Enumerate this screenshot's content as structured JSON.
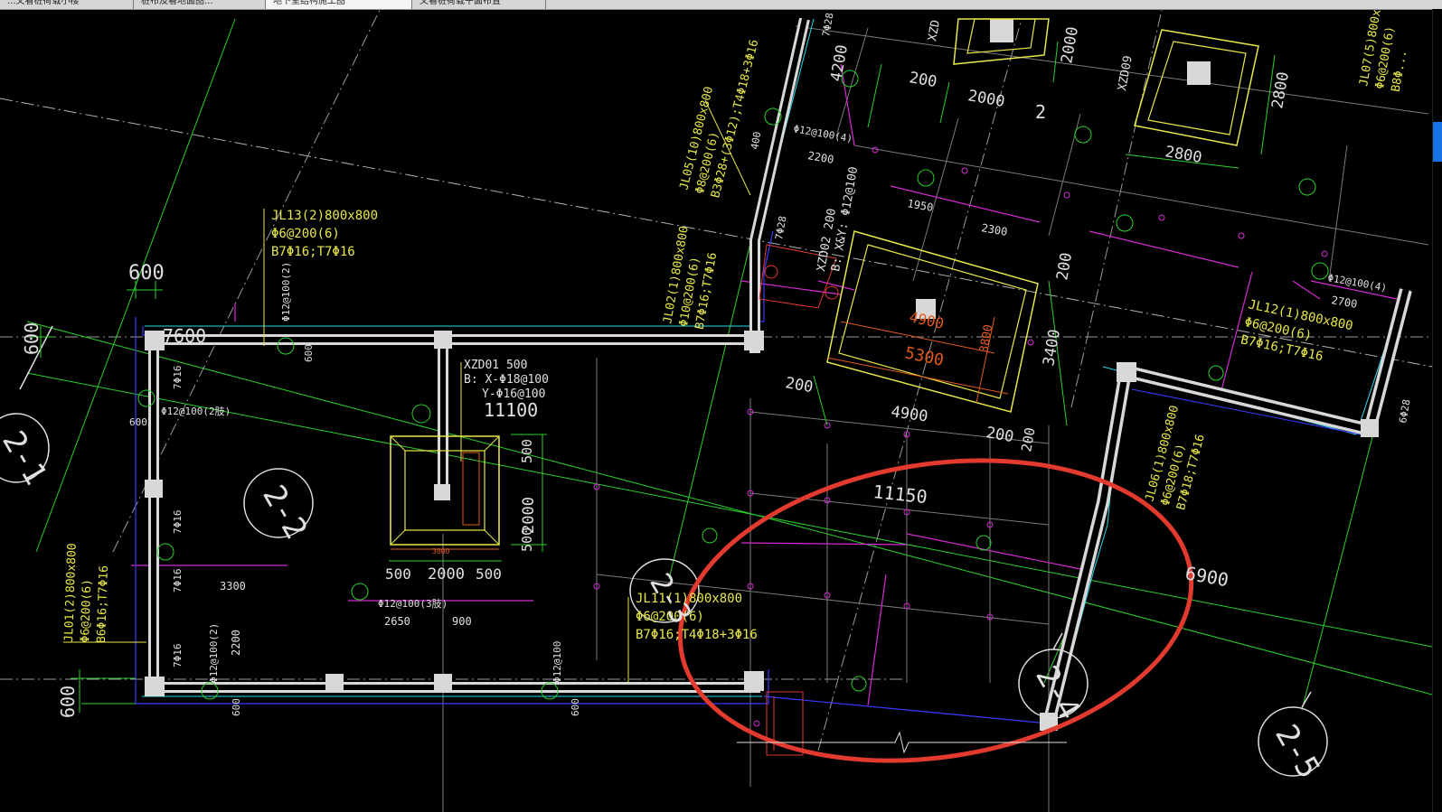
{
  "tabs": [
    {
      "label": "...又看桩荷载小楼"
    },
    {
      "label": "桩布及看地面图..."
    },
    {
      "label": "地下室结构施工图"
    },
    {
      "label": "又看桩荷载平面布置"
    }
  ],
  "beams": {
    "jl13": {
      "name": "JL13(2)800x800",
      "stirrup": "Φ6@200(6)",
      "rebar": "B7Φ16;T7Φ16"
    },
    "jl02": {
      "name": "JL02(1)800x800",
      "stirrup": "Φ10@200(6)",
      "rebar": "B7Φ16;T7Φ16"
    },
    "jl05": {
      "name": "JL05(10)800x800",
      "stirrup": "Φ8@200(6)",
      "rebar": "B3Φ28+(3Φ12);T4Φ18+3Φ16"
    },
    "jl01": {
      "name": "JL01(2)800x800",
      "stirrup": "Φ6@200(6)",
      "rebar": "B6Φ16;T7Φ16"
    },
    "jl11": {
      "name": "JL11(1)800x800",
      "stirrup": "Φ6@200(6)",
      "rebar": "B7Φ16;T4Φ18+3Φ16"
    },
    "jl12": {
      "name": "JL12(1)800x800",
      "stirrup": "Φ6@200(6)",
      "rebar": "B7Φ16;T7Φ16"
    },
    "jl06": {
      "name": "JL06(1)800x800",
      "stirrup": "Φ6@200(6)",
      "rebar": "B7Φ18;T7Φ16"
    },
    "jl07": {
      "name": "JL07(5)800x80",
      "stirrup": "Φ6@200(6)",
      "rebar": "B8Φ..."
    }
  },
  "caps": {
    "xzd01": {
      "name": "XZD01 500",
      "x_rebar": "B: X-Φ18@100",
      "y_rebar": "Y-Φ16@100"
    },
    "xzd02": {
      "name": "XZD02 200",
      "rebar": "B: X&Y: Φ12@100"
    },
    "xzd09": {
      "name": "XZD09"
    },
    "xzd_top": {
      "name": "XZD"
    }
  },
  "axes": {
    "a1": "2-1",
    "a2": "2-2",
    "a3": "2-3",
    "a4": "2-4",
    "a5": "2-5"
  },
  "dims": {
    "d600a": "600",
    "d600b": "600",
    "d600c": "600",
    "d7600": "7600",
    "d11100": "11100",
    "d11150": "11150",
    "d6900": "6900",
    "d4900": "4900",
    "d4900b": "4900",
    "d5300": "5300",
    "d3400": "3400",
    "d3800": "3800",
    "d200a": "200",
    "d200b": "200",
    "d200c": "200",
    "d200d": "200",
    "d200e": "200",
    "d2000a": "2000",
    "d2000b": "2000",
    "d2000c": "2000",
    "d2800a": "2800",
    "d2800b": "2800",
    "d4200": "4200",
    "d500a": "500",
    "d500b": "500",
    "d500c": "500",
    "d500d": "500",
    "d3000": "3000",
    "d3300": "3300",
    "d2650": "2650",
    "d900": "900",
    "d2200": "2200",
    "d1950": "2300",
    "d2300": "1950",
    "d2700": "2700",
    "d2": "2",
    "d400": "400"
  },
  "small": {
    "s7016a": "7Φ16",
    "s7016b": "7Φ16",
    "s7016c": "7Φ16",
    "s7016d": "7Φ16",
    "s7028a": "7Φ28",
    "s7028b": "7Φ28",
    "s6028": "6Φ28",
    "s1210a": "Φ12@100(2肢)",
    "s1210b": "Φ12@100(2)",
    "s1210c": "Φ12@100(3肢)",
    "s1210d": "Φ12@100(4)",
    "s1210e": "Φ12@100(4)",
    "s1210f": "Φ12@100",
    "s600v": "600",
    "s600h": "600"
  },
  "colors": {
    "highlight": "#e23a2e",
    "wall": "#d8d8d8",
    "grid": "#2ad02a",
    "beam": "#e8e84a",
    "magenta": "#d42ad4",
    "cyan": "#2ad8e8",
    "blue": "#3a3aff"
  }
}
